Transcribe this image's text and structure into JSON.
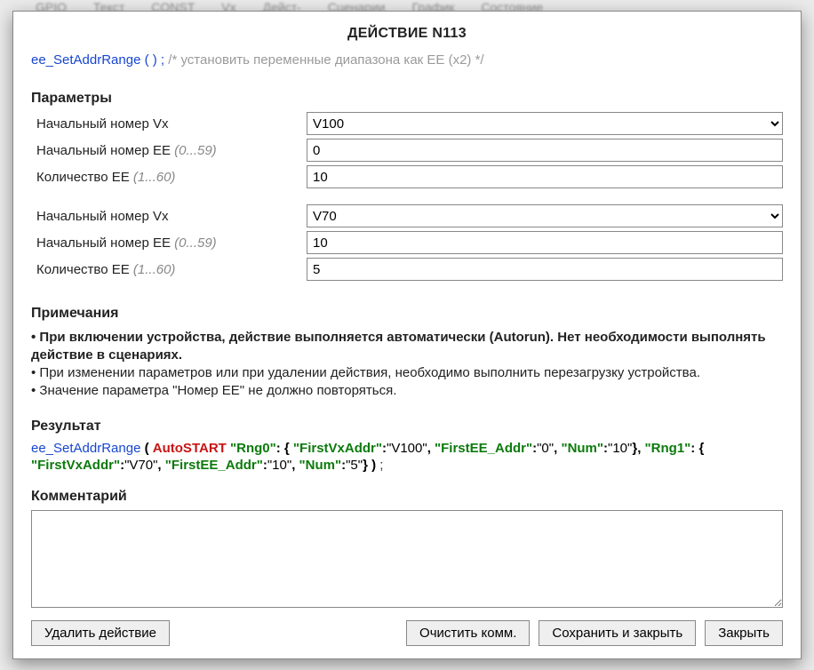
{
  "bg_tabs": [
    "GPIO",
    "Текст",
    "CONST",
    "Vx",
    "Дейст-",
    "Сценарии",
    "График",
    "Состояние"
  ],
  "modal": {
    "title": "ДЕЙСТВИЕ N113",
    "fn": {
      "name": "ee_SetAddrRange",
      "parens": " ( ) ;",
      "comment": "/* установить переменные диапазона как EE (x2) */"
    },
    "params_title": "Параметры",
    "blocks": [
      {
        "rows": [
          {
            "label": "Начальный номер Vx",
            "hint": "",
            "type": "select",
            "value": "V100"
          },
          {
            "label": "Начальный номер EE",
            "hint": "(0...59)",
            "type": "text",
            "value": "0"
          },
          {
            "label": "Количество EE",
            "hint": "(1...60)",
            "type": "text",
            "value": "10"
          }
        ]
      },
      {
        "rows": [
          {
            "label": "Начальный номер Vx",
            "hint": "",
            "type": "select",
            "value": "V70"
          },
          {
            "label": "Начальный номер EE",
            "hint": "(0...59)",
            "type": "text",
            "value": "10"
          },
          {
            "label": "Количество EE",
            "hint": "(1...60)",
            "type": "text",
            "value": "5"
          }
        ]
      }
    ],
    "notes_title": "Примечания",
    "notes": [
      {
        "bullet": "•",
        "text": "При включении устройства, действие выполняется автоматически (Autorun). Нет необходимости выполнять действие в сценариях.",
        "bold": true
      },
      {
        "bullet": "•",
        "text": "При изменении параметров или при удалении действия, необходимо выполнить перезагрузку устройства.",
        "bold": false
      },
      {
        "bullet": "•",
        "text": "Значение параметра \"Номер ЕЕ\" не должно повторяться.",
        "bold": false
      }
    ],
    "result_title": "Результат",
    "result": {
      "fn": "ee_SetAddrRange",
      "auto": "AutoSTART",
      "ranges": [
        {
          "name": "Rng0",
          "FirstVxAddr": "V100",
          "FirstEE_Addr": "0",
          "Num": "10"
        },
        {
          "name": "Rng1",
          "FirstVxAddr": "V70",
          "FirstEE_Addr": "10",
          "Num": "5"
        }
      ]
    },
    "comment_title": "Комментарий",
    "comment_value": "",
    "buttons": {
      "delete": "Удалить действие",
      "clear": "Очистить комм.",
      "save": "Сохранить и закрыть",
      "close": "Закрыть"
    }
  }
}
